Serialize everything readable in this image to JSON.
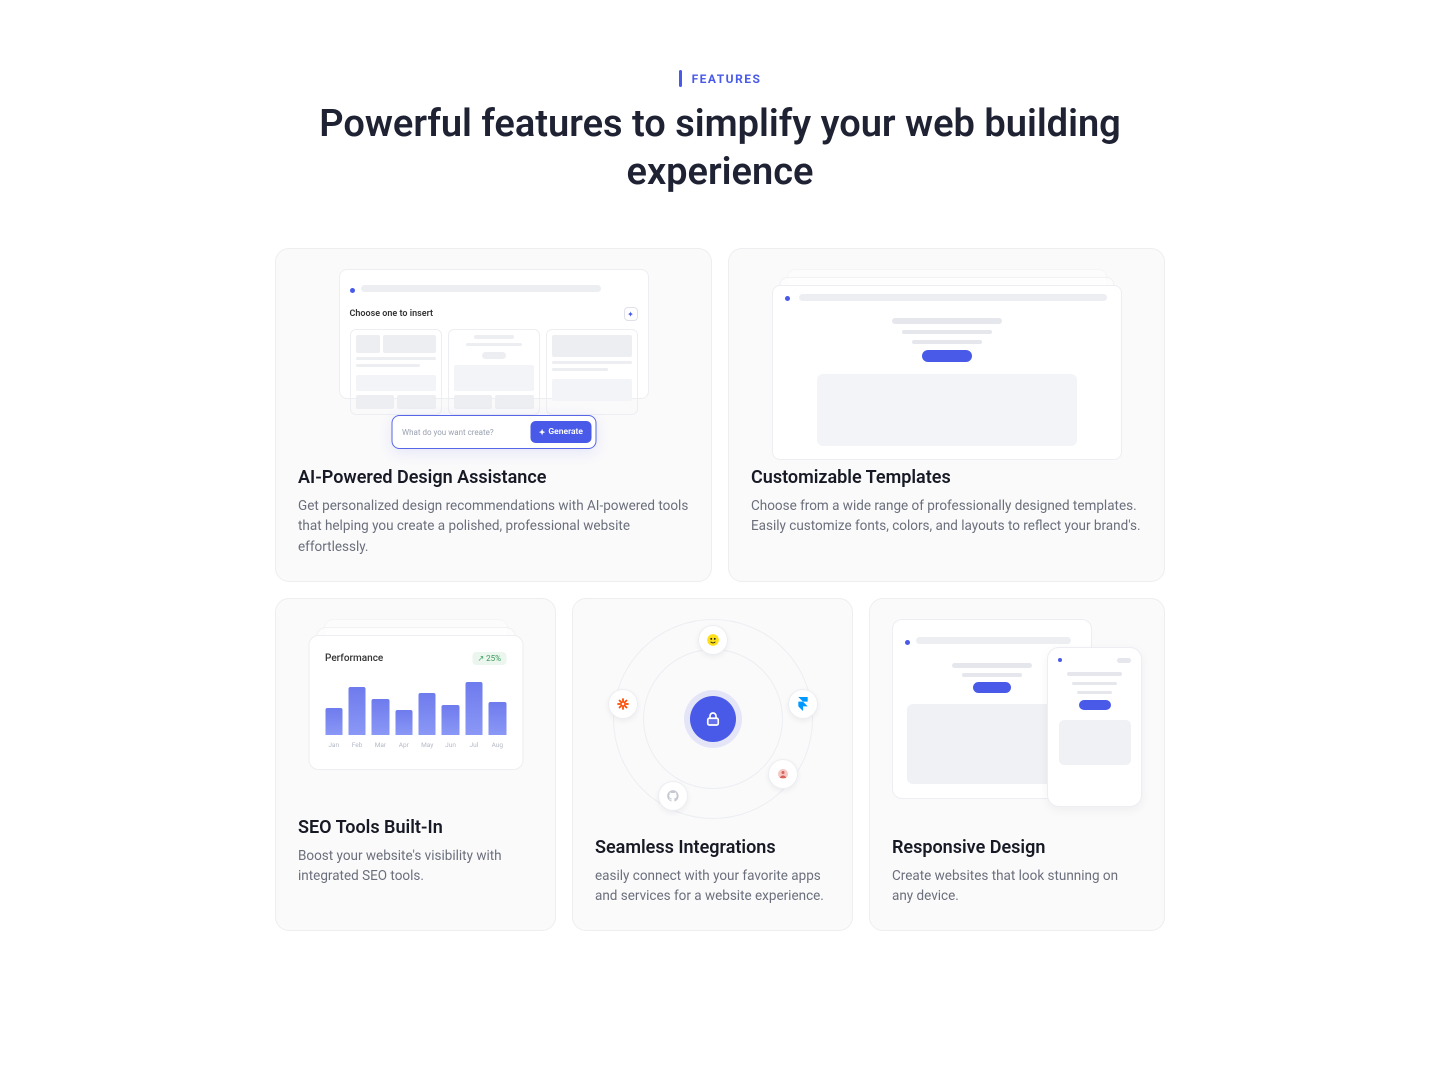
{
  "header": {
    "eyebrow": "FEATURES",
    "heading": "Powerful features to simplify your web building experience"
  },
  "cards": {
    "ai": {
      "title": "AI-Powered Design Assistance",
      "desc": "Get personalized design recommendations with AI-powered tools that helping you create a polished, professional website effortlessly.",
      "choose_label": "Choose one to insert",
      "prompt_placeholder": "What do you want create?",
      "generate_label": "Generate"
    },
    "templates": {
      "title": "Customizable Templates",
      "desc": "Choose from a wide range of professionally designed templates. Easily customize fonts, colors, and layouts to reflect your brand's."
    },
    "seo": {
      "title": "SEO Tools Built-In",
      "desc": "Boost your website's visibility with integrated SEO tools.",
      "performance_label": "Performance",
      "performance_value": "25%",
      "months": [
        "Jan",
        "Feb",
        "Mar",
        "Apr",
        "May",
        "Jun",
        "Jul",
        "Aug"
      ],
      "bars": [
        45,
        80,
        60,
        42,
        70,
        50,
        88,
        55
      ]
    },
    "integrations": {
      "title": "Seamless Integrations",
      "desc": "easily connect with your favorite apps and services for a website experience."
    },
    "responsive": {
      "title": "Responsive Design",
      "desc": "Create websites that look stunning on any device."
    }
  }
}
